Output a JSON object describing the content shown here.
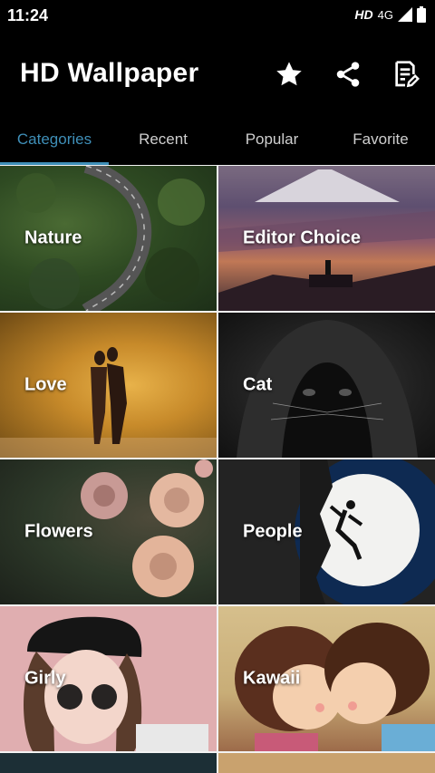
{
  "status": {
    "time": "11:24",
    "hd": "HD",
    "network": "4G"
  },
  "app": {
    "title": "HD Wallpaper"
  },
  "actions": {
    "favorite_icon": "star-icon",
    "share_icon": "share-icon",
    "notes_icon": "notes-edit-icon"
  },
  "tabs": [
    {
      "label": "Categories",
      "active": true
    },
    {
      "label": "Recent",
      "active": false
    },
    {
      "label": "Popular",
      "active": false
    },
    {
      "label": "Favorite",
      "active": false
    }
  ],
  "categories": [
    {
      "label": "Nature"
    },
    {
      "label": "Editor Choice"
    },
    {
      "label": "Love"
    },
    {
      "label": "Cat"
    },
    {
      "label": "Flowers"
    },
    {
      "label": "People"
    },
    {
      "label": "Girly"
    },
    {
      "label": "Kawaii"
    }
  ],
  "colors": {
    "accent": "#3f8fb8",
    "background": "#000000",
    "grid_gap": "#f2f2f2"
  }
}
